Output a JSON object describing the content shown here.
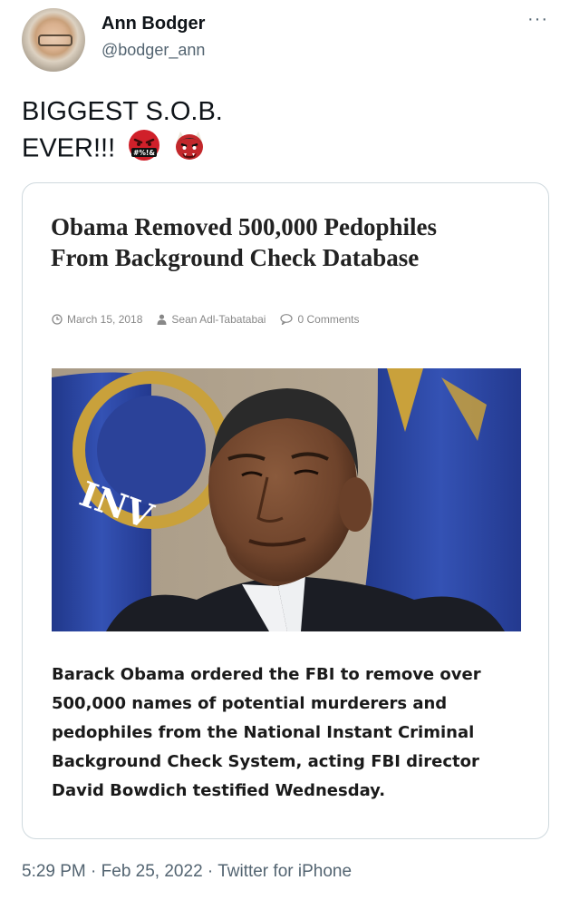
{
  "author": {
    "name": "Ann Bodger",
    "handle": "@bodger_ann"
  },
  "more_menu": "···",
  "tweet": {
    "line1": "BIGGEST S.O.B.",
    "line2": "EVER!!!"
  },
  "emojis": [
    {
      "icon": "angry-swearing-face-icon",
      "text": "#%!&"
    },
    {
      "icon": "ogre-face-icon"
    }
  ],
  "card": {
    "headline_line1": "Obama Removed 500,000 Pedophiles",
    "headline_line2": "From Background Check Database",
    "date": "March 15, 2018",
    "author": "Sean Adl-Tabatabai",
    "comments": "0 Comments",
    "photo_banner_text": "INV",
    "excerpt_lines": [
      "Barack Obama ordered the FBI to remove over",
      "500,000 names of potential murderers and",
      "pedophiles from the National Instant Criminal",
      "Background Check System, acting FBI director",
      "David Bowdich testified Wednesday."
    ]
  },
  "footer": {
    "time": "5:29 PM",
    "date": "Feb 25, 2022",
    "source": "Twitter for iPhone",
    "separator": "·"
  },
  "colors": {
    "text": "#0f1419",
    "secondary": "#536471",
    "border": "#cfd9de",
    "flag_blue": "#2c4aa6",
    "gold": "#c9a13b"
  }
}
